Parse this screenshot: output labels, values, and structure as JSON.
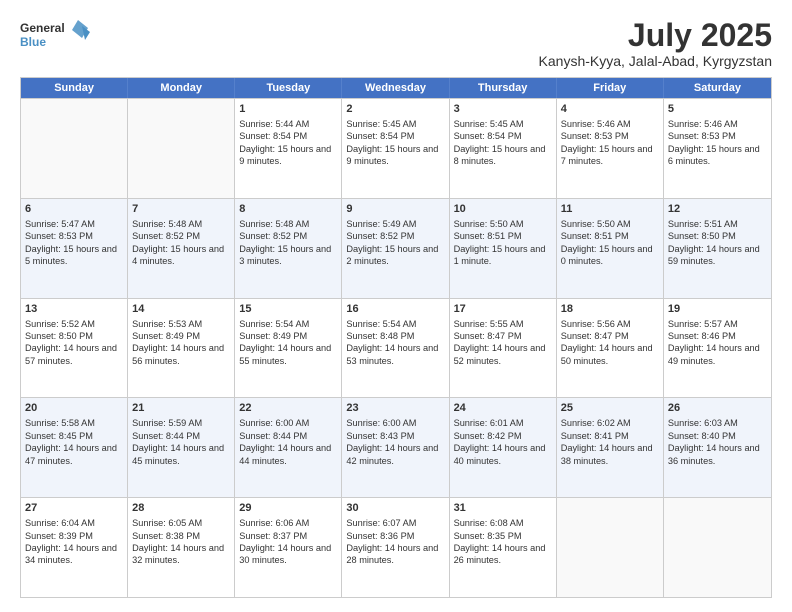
{
  "logo": {
    "line1": "General",
    "line2": "Blue"
  },
  "title": "July 2025",
  "subtitle": "Kanysh-Kyya, Jalal-Abad, Kyrgyzstan",
  "header_days": [
    "Sunday",
    "Monday",
    "Tuesday",
    "Wednesday",
    "Thursday",
    "Friday",
    "Saturday"
  ],
  "rows": [
    [
      {
        "day": "",
        "info": ""
      },
      {
        "day": "",
        "info": ""
      },
      {
        "day": "1",
        "info": "Sunrise: 5:44 AM\nSunset: 8:54 PM\nDaylight: 15 hours and 9 minutes."
      },
      {
        "day": "2",
        "info": "Sunrise: 5:45 AM\nSunset: 8:54 PM\nDaylight: 15 hours and 9 minutes."
      },
      {
        "day": "3",
        "info": "Sunrise: 5:45 AM\nSunset: 8:54 PM\nDaylight: 15 hours and 8 minutes."
      },
      {
        "day": "4",
        "info": "Sunrise: 5:46 AM\nSunset: 8:53 PM\nDaylight: 15 hours and 7 minutes."
      },
      {
        "day": "5",
        "info": "Sunrise: 5:46 AM\nSunset: 8:53 PM\nDaylight: 15 hours and 6 minutes."
      }
    ],
    [
      {
        "day": "6",
        "info": "Sunrise: 5:47 AM\nSunset: 8:53 PM\nDaylight: 15 hours and 5 minutes."
      },
      {
        "day": "7",
        "info": "Sunrise: 5:48 AM\nSunset: 8:52 PM\nDaylight: 15 hours and 4 minutes."
      },
      {
        "day": "8",
        "info": "Sunrise: 5:48 AM\nSunset: 8:52 PM\nDaylight: 15 hours and 3 minutes."
      },
      {
        "day": "9",
        "info": "Sunrise: 5:49 AM\nSunset: 8:52 PM\nDaylight: 15 hours and 2 minutes."
      },
      {
        "day": "10",
        "info": "Sunrise: 5:50 AM\nSunset: 8:51 PM\nDaylight: 15 hours and 1 minute."
      },
      {
        "day": "11",
        "info": "Sunrise: 5:50 AM\nSunset: 8:51 PM\nDaylight: 15 hours and 0 minutes."
      },
      {
        "day": "12",
        "info": "Sunrise: 5:51 AM\nSunset: 8:50 PM\nDaylight: 14 hours and 59 minutes."
      }
    ],
    [
      {
        "day": "13",
        "info": "Sunrise: 5:52 AM\nSunset: 8:50 PM\nDaylight: 14 hours and 57 minutes."
      },
      {
        "day": "14",
        "info": "Sunrise: 5:53 AM\nSunset: 8:49 PM\nDaylight: 14 hours and 56 minutes."
      },
      {
        "day": "15",
        "info": "Sunrise: 5:54 AM\nSunset: 8:49 PM\nDaylight: 14 hours and 55 minutes."
      },
      {
        "day": "16",
        "info": "Sunrise: 5:54 AM\nSunset: 8:48 PM\nDaylight: 14 hours and 53 minutes."
      },
      {
        "day": "17",
        "info": "Sunrise: 5:55 AM\nSunset: 8:47 PM\nDaylight: 14 hours and 52 minutes."
      },
      {
        "day": "18",
        "info": "Sunrise: 5:56 AM\nSunset: 8:47 PM\nDaylight: 14 hours and 50 minutes."
      },
      {
        "day": "19",
        "info": "Sunrise: 5:57 AM\nSunset: 8:46 PM\nDaylight: 14 hours and 49 minutes."
      }
    ],
    [
      {
        "day": "20",
        "info": "Sunrise: 5:58 AM\nSunset: 8:45 PM\nDaylight: 14 hours and 47 minutes."
      },
      {
        "day": "21",
        "info": "Sunrise: 5:59 AM\nSunset: 8:44 PM\nDaylight: 14 hours and 45 minutes."
      },
      {
        "day": "22",
        "info": "Sunrise: 6:00 AM\nSunset: 8:44 PM\nDaylight: 14 hours and 44 minutes."
      },
      {
        "day": "23",
        "info": "Sunrise: 6:00 AM\nSunset: 8:43 PM\nDaylight: 14 hours and 42 minutes."
      },
      {
        "day": "24",
        "info": "Sunrise: 6:01 AM\nSunset: 8:42 PM\nDaylight: 14 hours and 40 minutes."
      },
      {
        "day": "25",
        "info": "Sunrise: 6:02 AM\nSunset: 8:41 PM\nDaylight: 14 hours and 38 minutes."
      },
      {
        "day": "26",
        "info": "Sunrise: 6:03 AM\nSunset: 8:40 PM\nDaylight: 14 hours and 36 minutes."
      }
    ],
    [
      {
        "day": "27",
        "info": "Sunrise: 6:04 AM\nSunset: 8:39 PM\nDaylight: 14 hours and 34 minutes."
      },
      {
        "day": "28",
        "info": "Sunrise: 6:05 AM\nSunset: 8:38 PM\nDaylight: 14 hours and 32 minutes."
      },
      {
        "day": "29",
        "info": "Sunrise: 6:06 AM\nSunset: 8:37 PM\nDaylight: 14 hours and 30 minutes."
      },
      {
        "day": "30",
        "info": "Sunrise: 6:07 AM\nSunset: 8:36 PM\nDaylight: 14 hours and 28 minutes."
      },
      {
        "day": "31",
        "info": "Sunrise: 6:08 AM\nSunset: 8:35 PM\nDaylight: 14 hours and 26 minutes."
      },
      {
        "day": "",
        "info": ""
      },
      {
        "day": "",
        "info": ""
      }
    ]
  ]
}
